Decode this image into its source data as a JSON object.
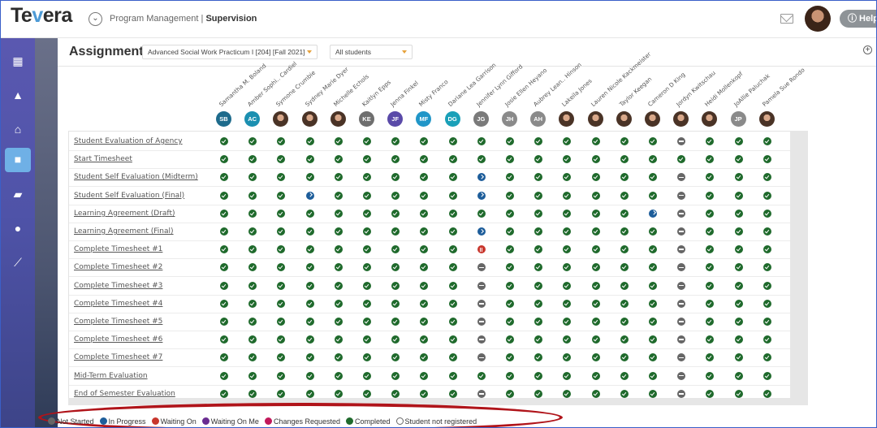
{
  "brand": {
    "name_prefix": "Te",
    "name_v": "v",
    "name_suffix": "era"
  },
  "header": {
    "breadcrumb_module": "Program Management",
    "breadcrumb_page": "Supervision",
    "help_label": "ⓘ Help"
  },
  "page": {
    "title": "Assignments",
    "course_select": "Advanced Social Work Practicum I [204] [Fall 2021]",
    "student_filter": "All students"
  },
  "icons": {
    "module": "chevron-down-circle-icon",
    "mail": "mail-icon",
    "add": "add-circle-icon"
  },
  "sidebar": [
    "dashboard-icon",
    "graduation-cap-icon",
    "institution-icon",
    "folder-icon",
    "briefcase-icon",
    "user-icon",
    "analytics-icon"
  ],
  "colors": {
    "completed": "#1f6a2c",
    "not_started": "#666666",
    "in_progress": "#1d5d9a",
    "waiting_on": "#c8362c",
    "waiting_on_me": "#6a2c91",
    "changes_requested": "#c2185b",
    "accent": "#e6a23c",
    "legend_ring": "#b0141a"
  },
  "students": [
    {
      "name": "Samantha M. Boland",
      "initials": "SB",
      "color": "#1e6b8c",
      "photo": false
    },
    {
      "name": "Amber Sophi.. Cardiel",
      "initials": "AC",
      "color": "#1b8fb0",
      "photo": false
    },
    {
      "name": "Symone Crumbie",
      "initials": "",
      "color": "#c8a67a",
      "photo": true
    },
    {
      "name": "Sydney Marie Dyer",
      "initials": "",
      "color": "#b47e5a",
      "photo": true
    },
    {
      "name": "Michelle Echols",
      "initials": "",
      "color": "#d08c7a",
      "photo": true
    },
    {
      "name": "Kaitlyn Epps",
      "initials": "KE",
      "color": "#6e6e6e",
      "photo": false
    },
    {
      "name": "Jenna Finkel",
      "initials": "JF",
      "color": "#5a4aa8",
      "photo": false
    },
    {
      "name": "Misty Franco",
      "initials": "MF",
      "color": "#2196c8",
      "photo": false
    },
    {
      "name": "Dariane Lea Garrison",
      "initials": "DG",
      "color": "#1aa0b8",
      "photo": false
    },
    {
      "name": "Jennifer Lynn Gifford",
      "initials": "JG",
      "color": "#7a7a7a",
      "photo": false
    },
    {
      "name": "Josie Ellen Heyano",
      "initials": "JH",
      "color": "#8a8a8a",
      "photo": false
    },
    {
      "name": "Aubrey Lean.. Hinson",
      "initials": "AH",
      "color": "#8a8a8a",
      "photo": false
    },
    {
      "name": "Lakeila Jones",
      "initials": "",
      "color": "#4a3326",
      "photo": true
    },
    {
      "name": "Lauren Nicole Kackmeister",
      "initials": "",
      "color": "#5b4636",
      "photo": true
    },
    {
      "name": "Taylor Keegan",
      "initials": "",
      "color": "#3f7ac8",
      "photo": true
    },
    {
      "name": "Cameron D King",
      "initials": "",
      "color": "#3b2a22",
      "photo": true
    },
    {
      "name": "Jordyn Kwitschau",
      "initials": "",
      "color": "#6a4a3a",
      "photo": true
    },
    {
      "name": "Heidi Mollenkopf",
      "initials": "",
      "color": "#5a3a2a",
      "photo": true
    },
    {
      "name": "JoAllie Paluchak",
      "initials": "JP",
      "color": "#8a8a8a",
      "photo": false
    },
    {
      "name": "Pamela Sue Rondo",
      "initials": "",
      "color": "#7a5a4a",
      "photo": true
    }
  ],
  "assignments": [
    {
      "label": "Student Evaluation of Agency",
      "statuses": [
        "c",
        "c",
        "c",
        "c",
        "c",
        "c",
        "c",
        "c",
        "c",
        "c",
        "c",
        "c",
        "c",
        "c",
        "c",
        "c",
        "n",
        "c",
        "c",
        "c"
      ]
    },
    {
      "label": "Start Timesheet",
      "statuses": [
        "c",
        "c",
        "c",
        "c",
        "c",
        "c",
        "c",
        "c",
        "c",
        "c",
        "c",
        "c",
        "c",
        "c",
        "c",
        "c",
        "c",
        "c",
        "c",
        "c"
      ]
    },
    {
      "label": "Student Self Evaluation (Midterm)",
      "statuses": [
        "c",
        "c",
        "c",
        "c",
        "c",
        "c",
        "c",
        "c",
        "c",
        "p",
        "c",
        "c",
        "c",
        "c",
        "c",
        "c",
        "n",
        "c",
        "c",
        "c"
      ]
    },
    {
      "label": "Student Self Evaluation (Final)",
      "statuses": [
        "c",
        "c",
        "c",
        "p",
        "c",
        "c",
        "c",
        "c",
        "c",
        "p",
        "c",
        "c",
        "c",
        "c",
        "c",
        "c",
        "n",
        "c",
        "c",
        "c"
      ]
    },
    {
      "label": "Learning Agreement (Draft)",
      "statuses": [
        "c",
        "c",
        "c",
        "c",
        "c",
        "c",
        "c",
        "c",
        "c",
        "c",
        "c",
        "c",
        "c",
        "c",
        "c",
        "p",
        "n",
        "c",
        "c",
        "c"
      ]
    },
    {
      "label": "Learning Agreement (Final)",
      "statuses": [
        "c",
        "c",
        "c",
        "c",
        "c",
        "c",
        "c",
        "c",
        "c",
        "p",
        "c",
        "c",
        "c",
        "c",
        "c",
        "c",
        "n",
        "c",
        "c",
        "c"
      ]
    },
    {
      "label": "Complete Timesheet #1",
      "statuses": [
        "c",
        "c",
        "c",
        "c",
        "c",
        "c",
        "c",
        "c",
        "c",
        "w",
        "c",
        "c",
        "c",
        "c",
        "c",
        "c",
        "n",
        "c",
        "c",
        "c"
      ]
    },
    {
      "label": "Complete Timesheet #2",
      "statuses": [
        "c",
        "c",
        "c",
        "c",
        "c",
        "c",
        "c",
        "c",
        "c",
        "n",
        "c",
        "c",
        "c",
        "c",
        "c",
        "c",
        "n",
        "c",
        "c",
        "c"
      ]
    },
    {
      "label": "Complete Timesheet #3",
      "statuses": [
        "c",
        "c",
        "c",
        "c",
        "c",
        "c",
        "c",
        "c",
        "c",
        "n",
        "c",
        "c",
        "c",
        "c",
        "c",
        "c",
        "n",
        "c",
        "c",
        "c"
      ]
    },
    {
      "label": "Complete Timesheet #4",
      "statuses": [
        "c",
        "c",
        "c",
        "c",
        "c",
        "c",
        "c",
        "c",
        "c",
        "n",
        "c",
        "c",
        "c",
        "c",
        "c",
        "c",
        "n",
        "c",
        "c",
        "c"
      ]
    },
    {
      "label": "Complete Timesheet #5",
      "statuses": [
        "c",
        "c",
        "c",
        "c",
        "c",
        "c",
        "c",
        "c",
        "c",
        "n",
        "c",
        "c",
        "c",
        "c",
        "c",
        "c",
        "n",
        "c",
        "c",
        "c"
      ]
    },
    {
      "label": "Complete Timesheet #6",
      "statuses": [
        "c",
        "c",
        "c",
        "c",
        "c",
        "c",
        "c",
        "c",
        "c",
        "n",
        "c",
        "c",
        "c",
        "c",
        "c",
        "c",
        "n",
        "c",
        "c",
        "c"
      ]
    },
    {
      "label": "Complete Timesheet #7",
      "statuses": [
        "c",
        "c",
        "c",
        "c",
        "c",
        "c",
        "c",
        "c",
        "c",
        "n",
        "c",
        "c",
        "c",
        "c",
        "c",
        "c",
        "n",
        "c",
        "c",
        "c"
      ]
    },
    {
      "label": "Mid-Term Evaluation",
      "statuses": [
        "c",
        "c",
        "c",
        "c",
        "c",
        "c",
        "c",
        "c",
        "c",
        "c",
        "c",
        "c",
        "c",
        "c",
        "c",
        "c",
        "n",
        "c",
        "c",
        "c"
      ]
    },
    {
      "label": "End of Semester Evaluation",
      "statuses": [
        "c",
        "c",
        "c",
        "c",
        "c",
        "c",
        "c",
        "c",
        "c",
        "n",
        "c",
        "c",
        "c",
        "c",
        "c",
        "c",
        "n",
        "c",
        "c",
        "c"
      ]
    }
  ],
  "legend": [
    {
      "label": "Not Started",
      "color": "#666666"
    },
    {
      "label": "In Progress",
      "color": "#1d5d9a"
    },
    {
      "label": "Waiting On",
      "color": "#c8362c"
    },
    {
      "label": "Waiting On Me",
      "color": "#6a2c91"
    },
    {
      "label": "Changes Requested",
      "color": "#c2185b"
    },
    {
      "label": "Completed",
      "color": "#1f6a2c"
    },
    {
      "label": "Student not registered",
      "color": "#ffffff"
    }
  ]
}
